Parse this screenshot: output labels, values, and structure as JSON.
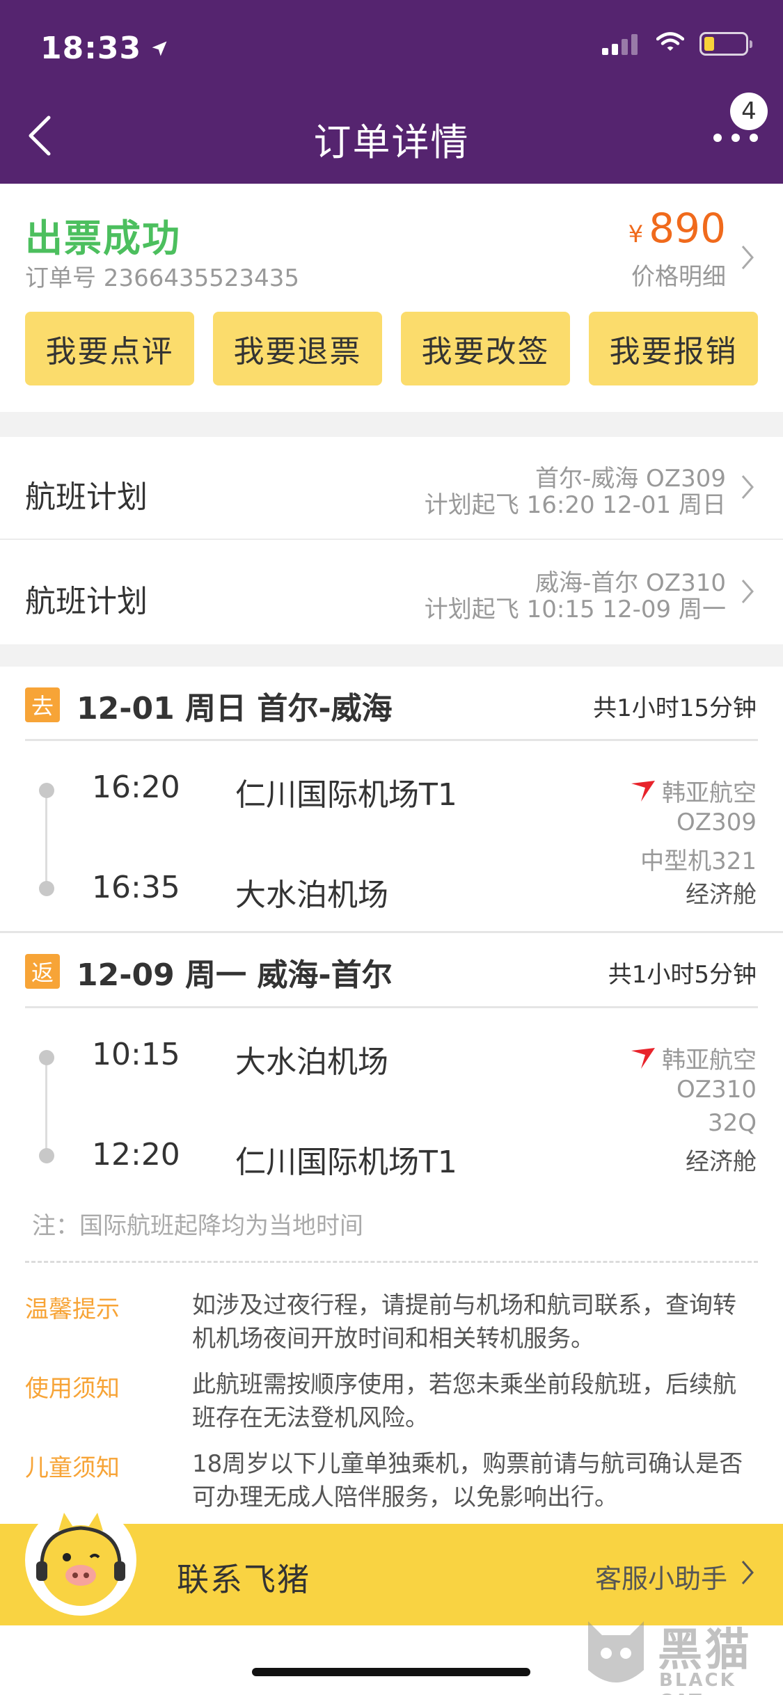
{
  "status_bar": {
    "time": "18:33",
    "location_icon": "location-arrow-icon",
    "signal_icon": "cell-signal-icon",
    "wifi_icon": "wifi-icon",
    "battery_icon": "battery-low-icon"
  },
  "nav": {
    "title": "订单详情",
    "back_icon": "back-chevron-icon",
    "more_icon": "more-dots-icon",
    "badge_count": "4"
  },
  "order": {
    "status": "出票成功",
    "order_no": "订单号 2366435523435",
    "currency": "¥",
    "price": "890",
    "price_detail": "价格明细",
    "actions": [
      {
        "label": "我要点评"
      },
      {
        "label": "我要退票"
      },
      {
        "label": "我要改签"
      },
      {
        "label": "我要报销"
      }
    ]
  },
  "plans": [
    {
      "label": "航班计划",
      "route": "首尔-威海 OZ309",
      "time": "计划起飞 16:20 12-01 周日"
    },
    {
      "label": "航班计划",
      "route": "威海-首尔 OZ310",
      "time": "计划起飞 10:15 12-09 周一"
    }
  ],
  "segments": [
    {
      "tag": "去",
      "title": "12-01 周日 首尔-威海",
      "duration": "共1小时15分钟",
      "dep_time": "16:20",
      "dep_airport": "仁川国际机场T1",
      "arr_time": "16:35",
      "arr_airport": "大水泊机场",
      "airline": "韩亚航空",
      "flight_no": "OZ309",
      "aircraft": "中型机321",
      "cabin": "经济舱"
    },
    {
      "tag": "返",
      "title": "12-09 周一 威海-首尔",
      "duration": "共1小时5分钟",
      "dep_time": "10:15",
      "dep_airport": "大水泊机场",
      "arr_time": "12:20",
      "arr_airport": "仁川国际机场T1",
      "airline": "韩亚航空",
      "flight_no": "OZ310",
      "aircraft": "32Q",
      "cabin": "经济舱"
    }
  ],
  "note": "注：国际航班起降均为当地时间",
  "tips": [
    {
      "label": "温馨提示",
      "text": "如涉及过夜行程，请提前与机场和航司联系，查询转机机场夜间开放时间和相关转机服务。"
    },
    {
      "label": "使用须知",
      "text": "此航班需按顺序使用，若您未乘坐前段航班，后续航班存在无法登机风险。"
    },
    {
      "label": "儿童须知",
      "text": "18周岁以下儿童单独乘机，购票前请与航司确认是否可办理无成人陪伴服务，以免影响出行。"
    }
  ],
  "contact": {
    "label": "联系飞猪",
    "assistant": "客服小助手"
  },
  "watermark": {
    "text": "黑猫",
    "sub": "BLACK CAT"
  },
  "colors": {
    "header": "#55246f",
    "success": "#4cbf5e",
    "price": "#f06a1c",
    "button": "#fbdc6c",
    "tag": "#f7a437",
    "contact_bar": "#f9d342"
  }
}
